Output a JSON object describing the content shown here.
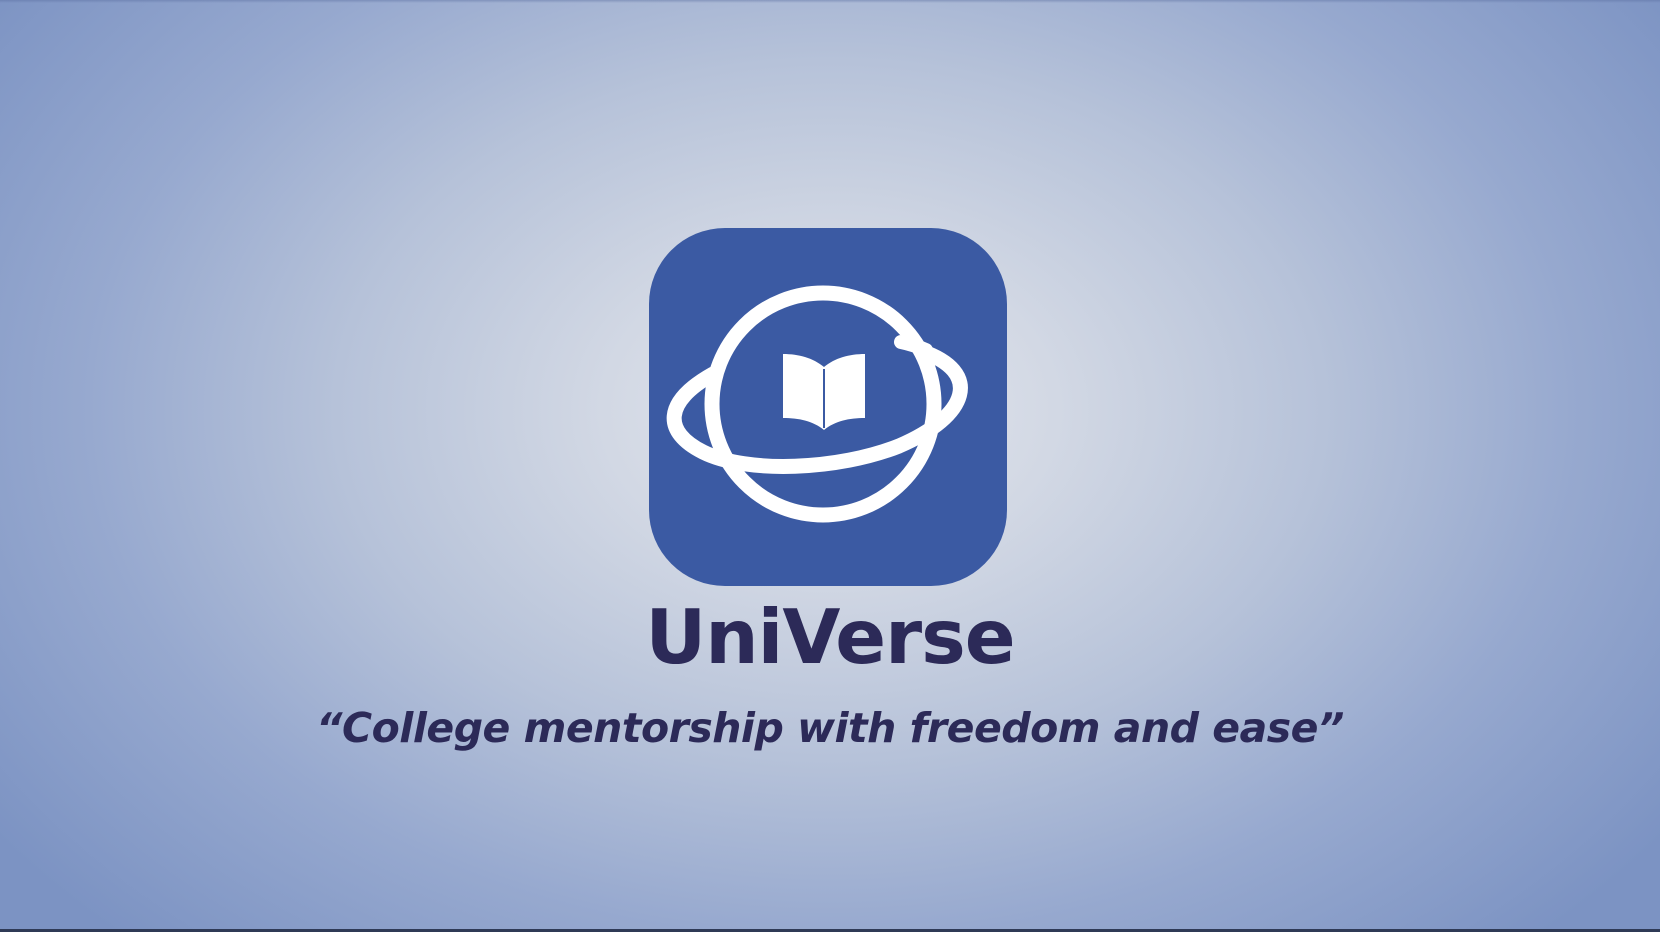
{
  "splash": {
    "app_name": "UniVerse",
    "tagline": "“College mentorship with freedom and ease”",
    "logo_icon": "planet-book-icon"
  },
  "colors": {
    "icon_background": "#3b5aa3",
    "icon_foreground": "#ffffff",
    "text": "#2c2a58",
    "background_center": "#e4e7ee",
    "background_edge": "#7c93c3"
  }
}
